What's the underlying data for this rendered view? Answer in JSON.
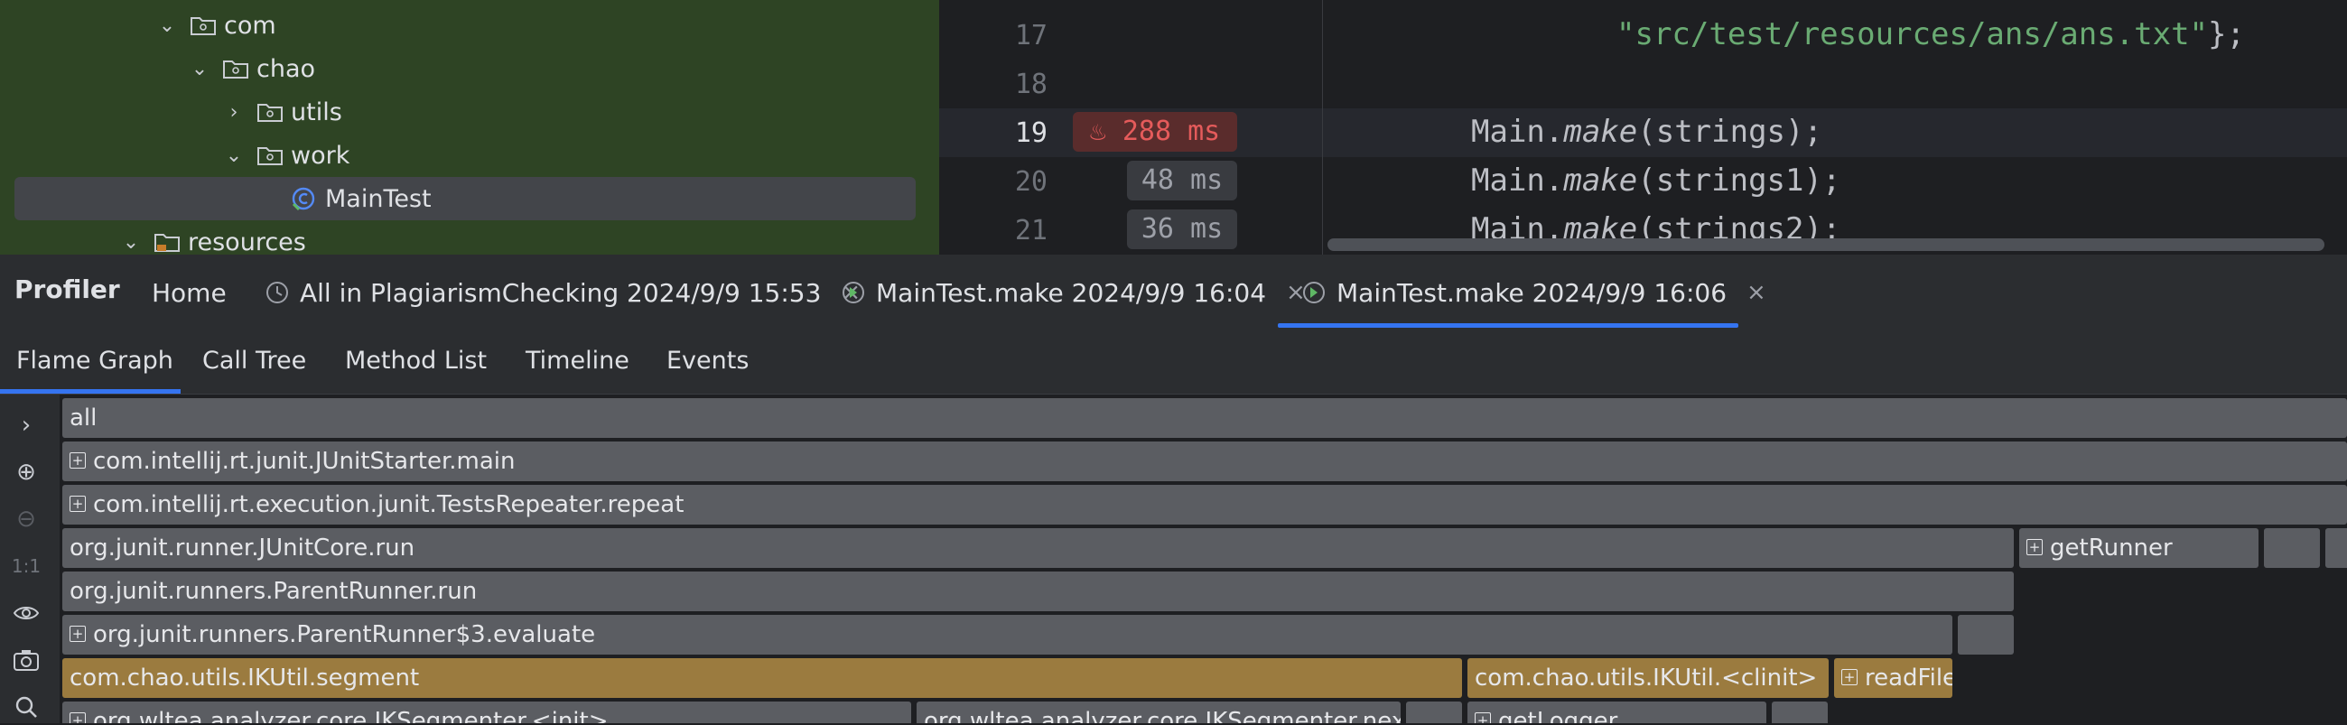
{
  "project_tree": {
    "items": [
      {
        "label": "com"
      },
      {
        "label": "chao"
      },
      {
        "label": "utils"
      },
      {
        "label": "work"
      },
      {
        "label": "MainTest"
      },
      {
        "label": "resources"
      }
    ]
  },
  "editor": {
    "lines": [
      {
        "number": "17",
        "code_string": "\"src/test/resources/ans/ans.txt\"",
        "code_tail": "};"
      },
      {
        "number": "18"
      },
      {
        "number": "19",
        "timing": "288 ms",
        "obj": "Main.",
        "method": "make",
        "args": "(strings);"
      },
      {
        "number": "20",
        "timing": "48 ms",
        "obj": "Main.",
        "method": "make",
        "args": "(strings1);"
      },
      {
        "number": "21",
        "timing": "36 ms",
        "obj": "Main.",
        "method": "make",
        "args": "(strings2);"
      }
    ]
  },
  "profiler": {
    "title": "Profiler",
    "tabs": [
      {
        "label": "Home"
      },
      {
        "label": "All in PlagiarismChecking 2024/9/9 15:53"
      },
      {
        "label": "MainTest.make 2024/9/9 16:04"
      },
      {
        "label": "MainTest.make 2024/9/9 16:06"
      }
    ],
    "active_tab": 3,
    "close_glyph": "×"
  },
  "subtabs": [
    {
      "label": "Flame Graph"
    },
    {
      "label": "Call Tree"
    },
    {
      "label": "Method List"
    },
    {
      "label": "Timeline"
    },
    {
      "label": "Events"
    }
  ],
  "flame_toolbar": {
    "expand": "›",
    "zoom_in": "⊕",
    "zoom_out": "⊖",
    "reset": "1:1",
    "eye": "👁",
    "camera": "camera",
    "search": "search"
  },
  "flame_graph": {
    "frames": [
      {
        "label": "all",
        "expandable": false
      },
      {
        "label": "com.intellij.rt.junit.JUnitStarter.main",
        "expandable": true
      },
      {
        "label": "com.intellij.rt.execution.junit.TestsRepeater.repeat",
        "expandable": true
      },
      {
        "label": "org.junit.runner.JUnitCore.run",
        "expandable": false
      },
      {
        "label": "getRunner",
        "expandable": true
      },
      {
        "label": "org.junit.runners.ParentRunner.run",
        "expandable": false
      },
      {
        "label": "org.junit.runners.ParentRunner$3.evaluate",
        "expandable": true
      },
      {
        "label": "com.chao.utils.IKUtil.segment",
        "expandable": false
      },
      {
        "label": "com.chao.utils.IKUtil.<clinit>",
        "expandable": false
      },
      {
        "label": "readFile",
        "expandable": true
      },
      {
        "label": "org.wltea.analyzer.core.IKSegmenter.<init>",
        "expandable": true
      },
      {
        "label": "org.wltea.analyzer.core.IKSegmenter.next",
        "expandable": false
      },
      {
        "label": "getLogger",
        "expandable": true
      }
    ]
  },
  "colors": {
    "accent": "#3574f0",
    "tree_bg": "#2e4424",
    "frame_gray": "#5b5d62",
    "frame_gold": "#9b7b3f",
    "hot_timing": "#e55b5b",
    "string": "#6aab73"
  }
}
